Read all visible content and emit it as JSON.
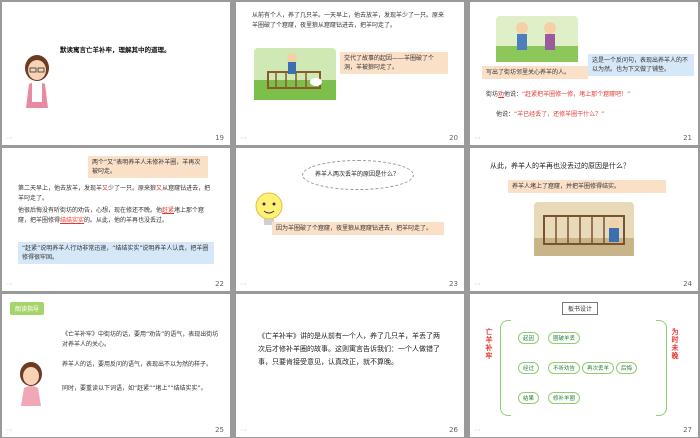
{
  "slides": {
    "s19": {
      "title": "默读寓言亡羊补牢，理解其中的道理。",
      "num": "19"
    },
    "s20": {
      "text": "从前有个人，养了几只羊。一天早上，他去放羊，发现羊少了一只。原来羊圈破了个窟窿，夜里狼从窟窿钻进去，把羊叼走了。",
      "note": "交代了故事的起因——羊圈破了个洞，羊被狼叼走了。",
      "num": "20"
    },
    "s21": {
      "quote_box": "这是一个反问句，表现出养羊人的不以为然。也为下文做了铺垫。",
      "caption": "写出了街坊邻里关心养羊的人。",
      "line1_pre": "街坊",
      "line1_hl": "劝",
      "line1_mid": "他说：",
      "line1_q": "“赶紧把羊圈修一修，堵上那个窟窿吧！”",
      "line2_pre": "他说：",
      "line2_q": "“羊已经丢了，还修羊圈干什么？”",
      "num": "21"
    },
    "s22": {
      "box1": "两个“又”表明养羊人未修补羊圈，羊再次被叼走。",
      "p1_a": "第二天早上，他去放羊，发现羊",
      "p1_b": "又",
      "p1_c": "少了一只。原来狼",
      "p1_d": "又",
      "p1_e": "从窟窿钻进去，把羊叼走了。",
      "p2_a": "他很后悔没有听街坊的劝告，心想，现在修还不晚。他",
      "p2_b": "赶紧",
      "p2_c": "堵上那个窟窿，把羊圈修得",
      "p2_d": "结结实实",
      "p2_e": "的。从此，他的羊再也没丢过。",
      "box2": "“赶紧”说明养羊人行动非常迅速，“结结实实”说明养羊人认真，把羊圈修得很牢固。",
      "num": "22"
    },
    "s23": {
      "thought": "养羊人两次丢羊的原因是什么？",
      "answer": "因为羊圈破了个窟窿，夜里狼从窟窿钻进去，把羊叼走了。",
      "num": "23"
    },
    "s24": {
      "question": "从此，养羊人的羊再也没丢过的原因是什么？",
      "answer": "养羊人堵上了窟窿，并把羊圈修得结实。",
      "num": "24"
    },
    "s25": {
      "tag": "朗读指导",
      "line1": "《亡羊补牢》中街坊的话，要用“劝告”的语气，表现出街坊对养羊人的关心。",
      "line2": "养羊人的话，要用反问的语气，表现出不以为然的样子。",
      "line3": "同时，要重读以下词语，如“赶紧”“堵上”“结结实实”。",
      "num": "25"
    },
    "s26": {
      "text": "《亡羊补牢》讲的是从前有一个人，养了几只羊，羊丢了两次后才修补羊圈的故事。这则寓言告诉我们：一个人做错了事，只要肯接受意见，认真改正，就不算晚。",
      "num": "26"
    },
    "s27": {
      "header": "板书设计",
      "left_vert": "亡羊补牢",
      "right_vert": "为时未晚",
      "row1": [
        "起因",
        "圈破羊丢"
      ],
      "row2": [
        "经过",
        "不听劝告",
        "再次丢羊",
        "后悔"
      ],
      "row3": [
        "结果",
        "修补羊圈"
      ],
      "num": "27"
    }
  },
  "colors": {
    "accent_red": "#e23a2f",
    "peach_box": "#fbe0c8",
    "blue_box": "#d6e8f8",
    "green": "#a5d46a"
  }
}
